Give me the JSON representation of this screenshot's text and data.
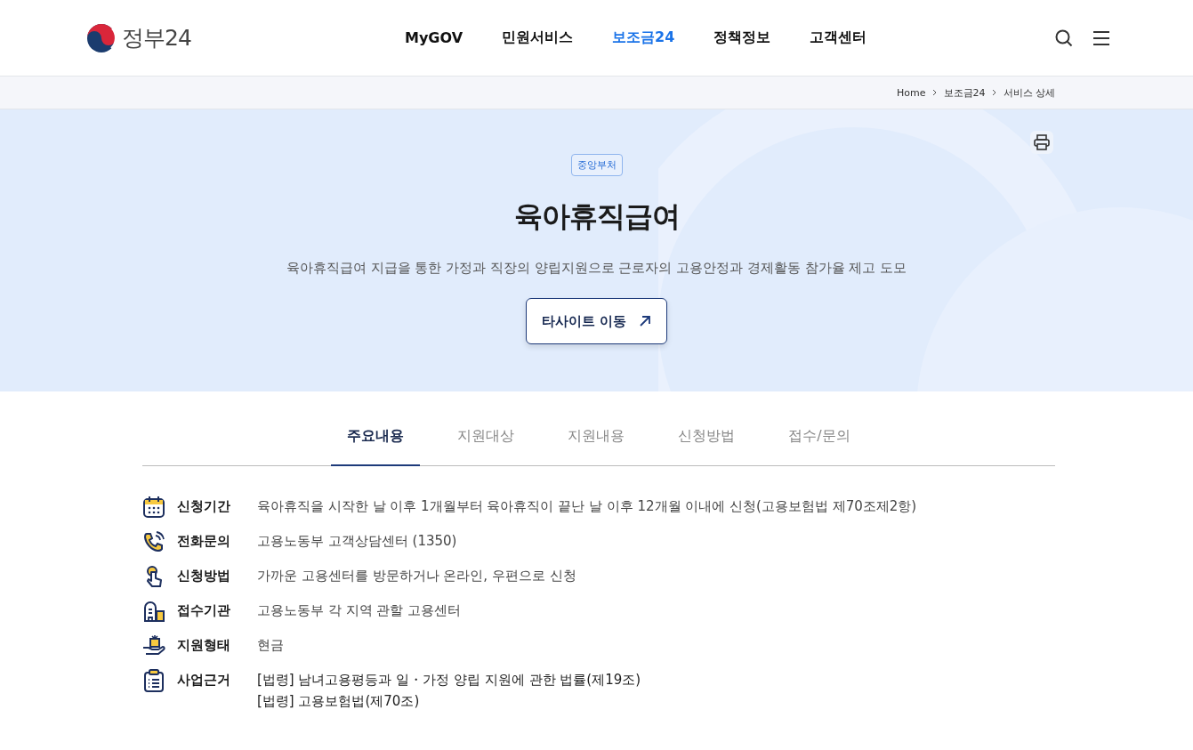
{
  "header": {
    "logo_text": "정부24",
    "nav": [
      {
        "label": "MyGOV",
        "selected": false
      },
      {
        "label": "민원서비스",
        "selected": false
      },
      {
        "label": "보조금24",
        "selected": true
      },
      {
        "label": "정책정보",
        "selected": false
      },
      {
        "label": "고객센터",
        "selected": false
      }
    ]
  },
  "breadcrumb": [
    "Home",
    "보조금24",
    "서비스 상세"
  ],
  "hero": {
    "badge": "중앙부처",
    "title": "육아휴직급여",
    "description": "육아휴직급여 지급을 통한 가정과 직장의 양립지원으로 근로자의 고용안정과 경제활동 참가율 제고 도모",
    "button": "타사이트 이동"
  },
  "tabs": [
    {
      "label": "주요내용",
      "selected": true
    },
    {
      "label": "지원대상",
      "selected": false
    },
    {
      "label": "지원내용",
      "selected": false
    },
    {
      "label": "신청방법",
      "selected": false
    },
    {
      "label": "접수/문의",
      "selected": false
    }
  ],
  "details": [
    {
      "kind": "calendar",
      "label": "신청기간",
      "lines": [
        "육아휴직을 시작한 날 이후 1개월부터 육아휴직이 끝난 날 이후 12개월 이내에 신청(고용보험법 제70조제2항)"
      ]
    },
    {
      "kind": "phone",
      "label": "전화문의",
      "lines": [
        "고용노동부 고객상담센터 (1350)"
      ]
    },
    {
      "kind": "hand",
      "label": "신청방법",
      "lines": [
        "가까운 고용센터를 방문하거나 온라인, 우편으로 신청"
      ]
    },
    {
      "kind": "building",
      "label": "접수기관",
      "lines": [
        "고용노동부 각 지역 관할 고용센터"
      ]
    },
    {
      "kind": "gift",
      "label": "지원형태",
      "lines": [
        "현금"
      ]
    },
    {
      "kind": "clipboard",
      "label": "사업근거",
      "lines": [
        "[법령] 남녀고용평등과 일・가정 양립 지원에 관한 법률(제19조)",
        "[법령] 고용보험법(제70조)"
      ]
    }
  ]
}
